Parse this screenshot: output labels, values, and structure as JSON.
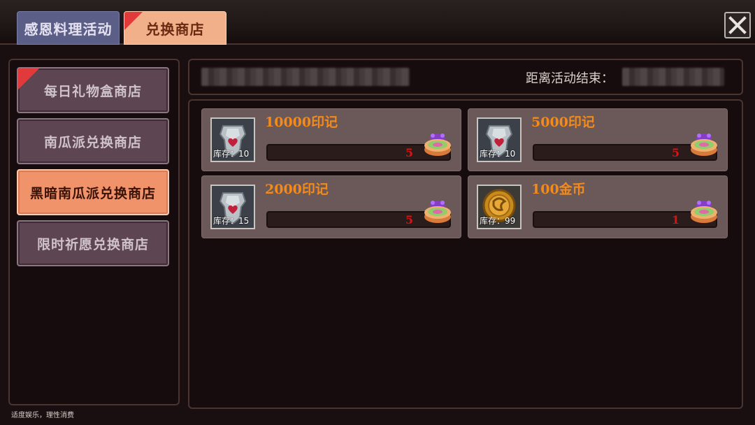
{
  "tabs": [
    {
      "label": "感恩料理活动"
    },
    {
      "label": "兑换商店"
    }
  ],
  "sidebar": {
    "items": [
      {
        "label": "每日礼物盒商店"
      },
      {
        "label": "南瓜派兑换商店"
      },
      {
        "label": "黑暗南瓜派兑换商店"
      },
      {
        "label": "限时祈愿兑换商店"
      }
    ]
  },
  "header": {
    "countdown_label": "距离活动结束："
  },
  "items": [
    {
      "title": "10000印记",
      "stock": "库存：10",
      "price": "5",
      "icon": "shield-heart-icon"
    },
    {
      "title": "5000印记",
      "stock": "库存：10",
      "price": "5",
      "icon": "shield-heart-icon"
    },
    {
      "title": "2000印记",
      "stock": "库存：15",
      "price": "5",
      "icon": "shield-heart-icon"
    },
    {
      "title": "100金币",
      "stock": "库存：99",
      "price": "1",
      "icon": "gold-coin-icon"
    }
  ],
  "footer": {
    "note": "适度娱乐，理性消费"
  },
  "colors": {
    "title_orange": "#f28a1c",
    "price_red": "#e01010",
    "active_tab": "#f2b08a",
    "inactive_tab": "#5b5e86",
    "active_sidebar": "#f0926a"
  }
}
